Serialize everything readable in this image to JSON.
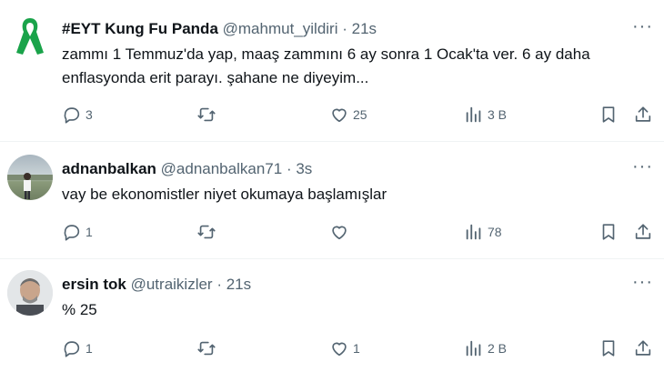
{
  "tweets": [
    {
      "display_name": "#EYT Kung Fu Panda",
      "handle": "@mahmut_yildiri",
      "time": "· 21s",
      "text": "zammı 1 Temmuz'da yap, maaş zammını 6 ay sonra 1 Ocak'ta ver. 6 ay daha\nenflasyonda erit parayı. şahane ne diyeyim...",
      "replies": "3",
      "retweets": "",
      "likes": "25",
      "views": "3 B"
    },
    {
      "display_name": "adnanbalkan",
      "handle": "@adnanbalkan71",
      "time": "· 3s",
      "text": "vay be ekonomistler niyet okumaya başlamışlar",
      "replies": "1",
      "retweets": "",
      "likes": "",
      "views": "78"
    },
    {
      "display_name": "ersin tok",
      "handle": "@utraikizler",
      "time": "· 21s",
      "text": "% 25",
      "replies": "1",
      "retweets": "",
      "likes": "1",
      "views": "2 B"
    }
  ],
  "colors": {
    "muted": "#536471",
    "ribbon": "#1aa34a",
    "divider": "#eff3f4"
  },
  "icons": [
    "green-ribbon-icon",
    "reply-icon",
    "retweet-icon",
    "like-icon",
    "views-icon",
    "bookmark-icon",
    "share-icon",
    "more-icon"
  ]
}
